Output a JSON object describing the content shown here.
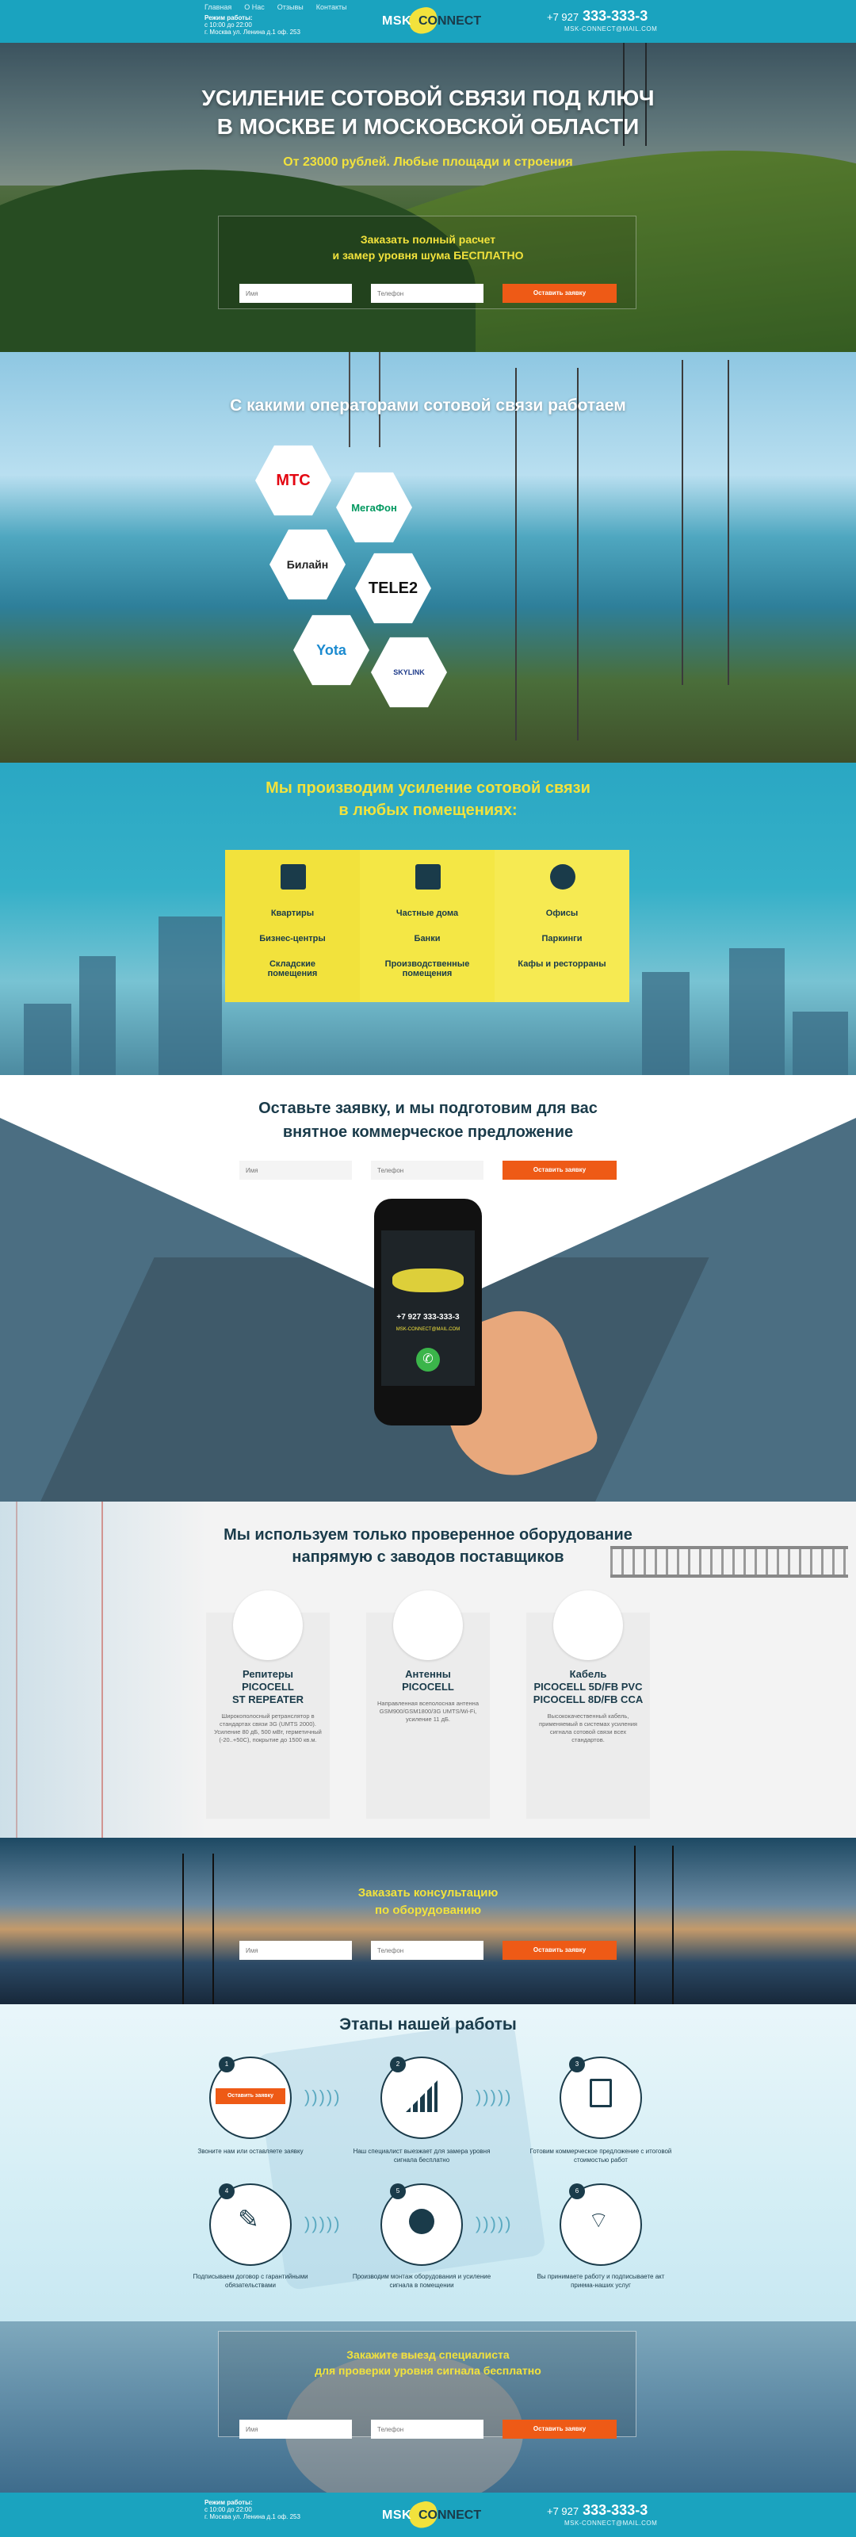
{
  "header": {
    "nav": [
      "Главная",
      "О Нас",
      "Отзывы",
      "Контакты"
    ],
    "hours_label": "Режим работы:",
    "hours": "с 10:00 до 22:00",
    "address": "г. Москва ул. Ленина д.1 оф. 253",
    "logo_a": "MSK",
    "logo_b": "CONNECT",
    "phone_prefix": "+7 927",
    "phone_main": "333-333-3",
    "email": "MSK-CONNECT@MAIL.COM"
  },
  "hero": {
    "title_line1": "УСИЛЕНИЕ СОТОВОЙ СВЯЗИ ПОД КЛЮЧ",
    "title_line2": "В МОСКВЕ И МОСКОВСКОЙ ОБЛАСТИ",
    "subtitle": "От 23000 рублей. Любые площади и строения",
    "form_line1": "Заказать полный расчет",
    "form_line2": "и замер уровня шума БЕСПЛАТНО",
    "name_placeholder": "Имя",
    "phone_placeholder": "Телефон",
    "button": "Оставить заявку"
  },
  "operators": {
    "title": "С какими операторами сотовой связи работаем",
    "items": [
      "МТС",
      "МегаФон",
      "Билайн",
      "TELE2",
      "Yota",
      "SKYLINK"
    ]
  },
  "premises": {
    "title_line1": "Мы производим усиление сотовой связи",
    "title_line2": "в любых помещениях:",
    "col1": [
      "Квартиры",
      "Бизнес-центры",
      "Складские помещения"
    ],
    "col2": [
      "Частные дома",
      "Банки",
      "Производственные помещения"
    ],
    "col3": [
      "Офисы",
      "Паркинги",
      "Кафы и ресторраны"
    ]
  },
  "offer": {
    "title_line1": "Оставьте заявку, и мы подготовим для вас",
    "title_line2": "внятное коммерческое предложение",
    "name_placeholder": "Имя",
    "phone_placeholder": "Телефон",
    "button": "Оставить заявку",
    "phone_screen_number": "+7 927 333-333-3",
    "phone_screen_email": "MSK-CONNECT@MAIL.COM"
  },
  "equipment": {
    "title_line1": "Мы используем только проверенное оборудование",
    "title_line2": "напрямую с заводов поставщиков",
    "items": [
      {
        "name1": "Репитеры",
        "name2": "PICOCELL",
        "name3": "ST REPEATER",
        "desc": "Широкополосный ретранслятор в стандартах связи 3G (UMTS 2000). Усиление 80 дБ, 500 мВт, герметичный (-20..+50С), покрытие до 1500 кв.м."
      },
      {
        "name1": "Антенны",
        "name2": "PICOCELL",
        "name3": "",
        "desc": "Направленная всеполосная антенна GSM900/GSM1800/3G UMTS/Wi-Fi, усиление 11 дБ."
      },
      {
        "name1": "Кабель",
        "name2": "PICOCELL 5D/FB PVC",
        "name3": "PICOCELL 8D/FB CCA",
        "desc": "Высококачественный кабель, применяемый в системах усиления сигнала сотовой связи всех стандартов."
      }
    ]
  },
  "consult": {
    "line1": "Заказать консультацию",
    "line2": "по оборудованию",
    "name_placeholder": "Имя",
    "phone_placeholder": "Телефон",
    "button": "Оставить заявку"
  },
  "stages": {
    "title": "Этапы нашей работы",
    "button": "Оставить заявку",
    "items": [
      {
        "n": "1",
        "text": "Звоните нам или оставляете заявку"
      },
      {
        "n": "2",
        "text": "Наш специалист выезжает для замера уровня сигнала бесплатно"
      },
      {
        "n": "3",
        "text": "Готовим коммерческое предложение с итоговой стоимостью работ"
      },
      {
        "n": "4",
        "text": "Подписываем договор с гарантийными обязательствами"
      },
      {
        "n": "5",
        "text": "Производим монтаж оборудования и усиление сигнала в помещении"
      },
      {
        "n": "6",
        "text": "Вы принимаете работу и подписываете акт приема-наших услуг"
      }
    ]
  },
  "bottom_form": {
    "line1": "Закажите выезд специалиста",
    "line2": "для проверки уровня сигнала бесплатно",
    "name_placeholder": "Имя",
    "phone_placeholder": "Телефон",
    "button": "Оставить заявку"
  },
  "colors": {
    "accent": "#1aa3bf",
    "yellow": "#f2e23c",
    "orange": "#ee5a16",
    "dark": "#1a3b4a"
  }
}
